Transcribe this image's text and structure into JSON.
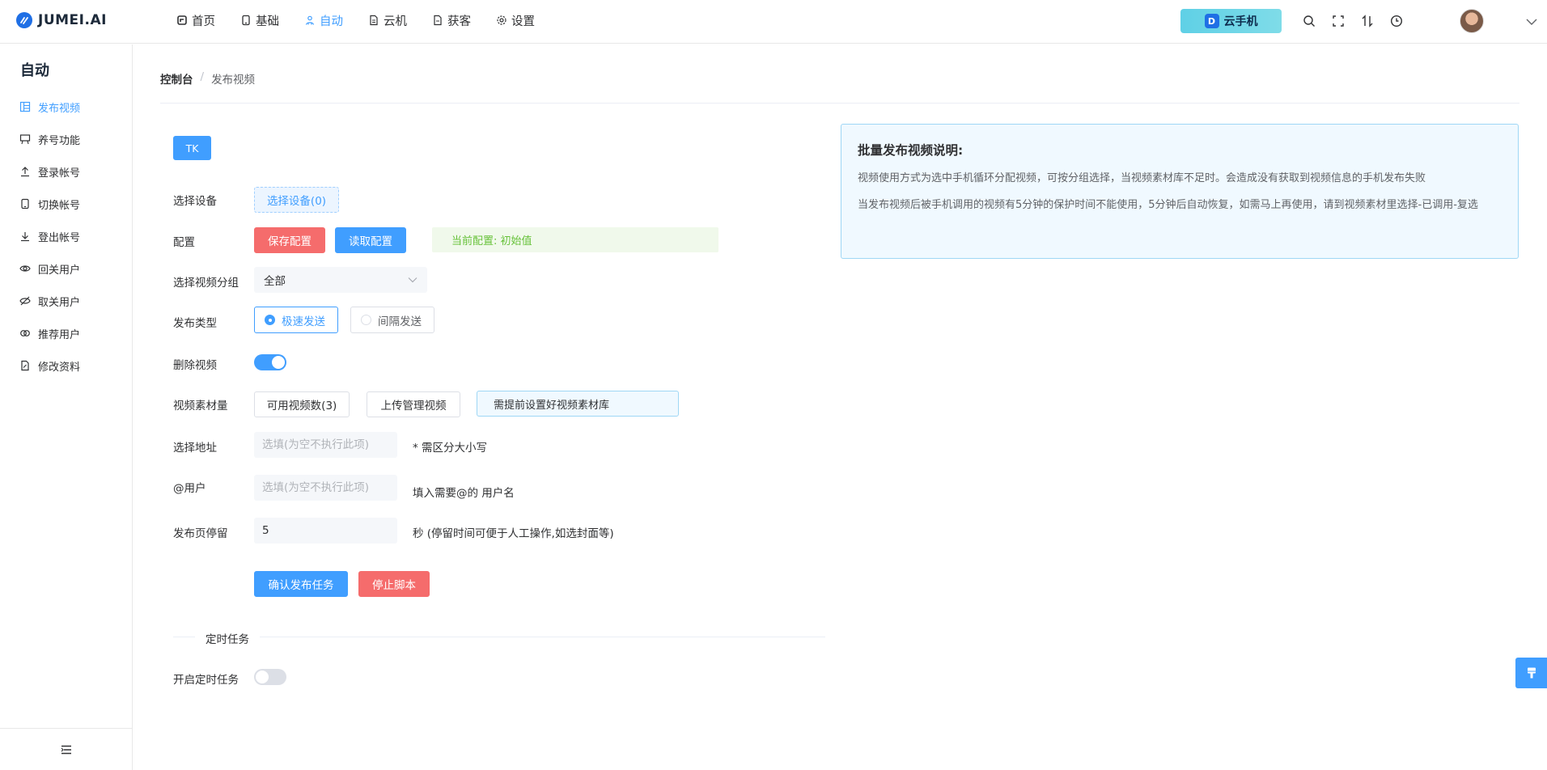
{
  "brand": {
    "logo_text": "JUMEI.AI"
  },
  "nav": [
    {
      "label": "首页",
      "icon": "home-icon",
      "active": false
    },
    {
      "label": "基础",
      "icon": "phone-icon",
      "active": false
    },
    {
      "label": "自动",
      "icon": "robot-icon",
      "active": true
    },
    {
      "label": "云机",
      "icon": "document-icon",
      "active": false
    },
    {
      "label": "获客",
      "icon": "file-icon",
      "active": false
    },
    {
      "label": "设置",
      "icon": "gear-icon",
      "active": false
    }
  ],
  "header": {
    "cloud_phone_label": "云手机",
    "cloud_phone_badge": "D"
  },
  "sidebar": {
    "title": "自动",
    "items": [
      {
        "label": "发布视频",
        "icon": "grid-icon",
        "active": true
      },
      {
        "label": "养号功能",
        "icon": "easel-icon",
        "active": false
      },
      {
        "label": "登录帐号",
        "icon": "upload-icon",
        "active": false
      },
      {
        "label": "切换帐号",
        "icon": "phone-icon",
        "active": false
      },
      {
        "label": "登出帐号",
        "icon": "download-icon",
        "active": false
      },
      {
        "label": "回关用户",
        "icon": "eye-icon",
        "active": false
      },
      {
        "label": "取关用户",
        "icon": "eye-off-icon",
        "active": false
      },
      {
        "label": "推荐用户",
        "icon": "link-icon",
        "active": false
      },
      {
        "label": "修改资料",
        "icon": "edit-doc-icon",
        "active": false
      }
    ]
  },
  "breadcrumb": {
    "root": "控制台",
    "separator": "/",
    "current": "发布视频"
  },
  "form": {
    "platform_tab": "TK",
    "device": {
      "label": "选择设备",
      "button": "选择设备(0)"
    },
    "config": {
      "label": "配置",
      "save": "保存配置",
      "load": "读取配置",
      "current": "当前配置: 初始值"
    },
    "video_group": {
      "label": "选择视频分组",
      "value": "全部"
    },
    "publish_type": {
      "label": "发布类型",
      "options": [
        "极速发送",
        "间隔发送"
      ],
      "selected": 0
    },
    "delete_video": {
      "label": "删除视频",
      "enabled": true
    },
    "material": {
      "label": "视频素材量",
      "available": "可用视频数(3)",
      "upload": "上传管理视频",
      "hint": "需提前设置好视频素材库"
    },
    "location": {
      "label": "选择地址",
      "placeholder": "选填(为空不执行此项)",
      "note": "* 需区分大小写"
    },
    "mention": {
      "label": "@用户",
      "placeholder": "选填(为空不执行此项)",
      "note": "填入需要@的 用户名"
    },
    "stay": {
      "label": "发布页停留",
      "value": "5",
      "note": "秒 (停留时间可便于人工操作,如选封面等)"
    },
    "actions": {
      "confirm": "确认发布任务",
      "stop": "停止脚本"
    }
  },
  "schedule": {
    "section_title": "定时任务",
    "label": "开启定时任务",
    "enabled": false
  },
  "info": {
    "title": "批量发布视频说明:",
    "paragraphs": [
      "视频使用方式为选中手机循环分配视频，可按分组选择，当视频素材库不足时。会造成没有获取到视频信息的手机发布失败",
      "当发布视频后被手机调用的视频有5分钟的保护时间不能使用，5分钟后自动恢复，如需马上再使用，请到视频素材里选择-已调用-复选"
    ]
  },
  "colors": {
    "primary": "#409eff",
    "danger": "#f56c6c",
    "success_text": "#67c23a"
  }
}
